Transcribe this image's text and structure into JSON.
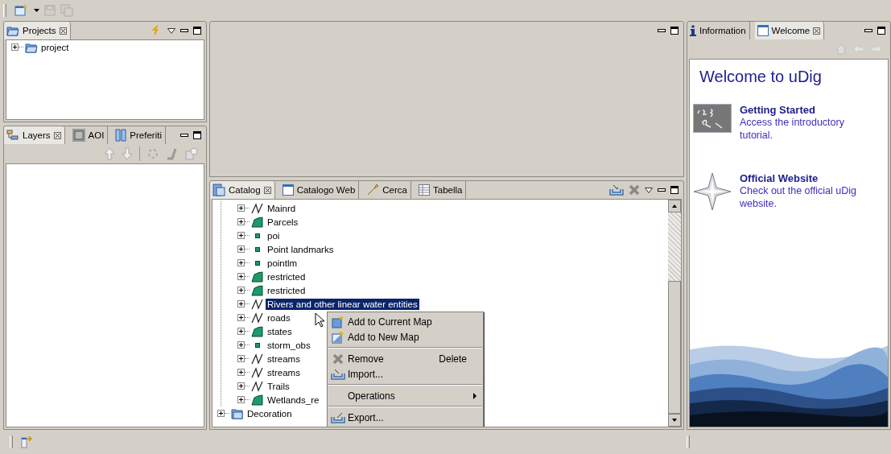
{
  "projects_panel": {
    "tabs": [
      {
        "label": "Projects",
        "selected": true,
        "closable": true
      }
    ],
    "items": [
      {
        "label": "project",
        "expanded": false
      }
    ]
  },
  "layers_panel": {
    "tabs": [
      {
        "label": "Layers",
        "selected": true,
        "closable": true
      },
      {
        "label": "AOI",
        "selected": false,
        "closable": false
      },
      {
        "label": "Preferiti",
        "selected": false,
        "closable": false
      }
    ]
  },
  "catalog_panel": {
    "tabs": [
      {
        "label": "Catalog",
        "selected": true,
        "closable": true
      },
      {
        "label": "Catalogo Web",
        "selected": false,
        "closable": false
      },
      {
        "label": "Cerca",
        "selected": false,
        "closable": false
      },
      {
        "label": "Tabella",
        "selected": false,
        "closable": false
      }
    ],
    "layers": [
      {
        "label": "Mainrd",
        "kind": "line",
        "selected": false
      },
      {
        "label": "Parcels",
        "kind": "polygon",
        "selected": false
      },
      {
        "label": "poi",
        "kind": "point",
        "selected": false
      },
      {
        "label": "Point landmarks",
        "kind": "point",
        "selected": false
      },
      {
        "label": "pointlm",
        "kind": "point",
        "selected": false
      },
      {
        "label": "restricted",
        "kind": "polygon",
        "selected": false
      },
      {
        "label": "restricted",
        "kind": "polygon",
        "selected": false
      },
      {
        "label": "Rivers and other linear water entities",
        "kind": "line",
        "selected": true
      },
      {
        "label": "roads",
        "kind": "line",
        "selected": false
      },
      {
        "label": "states",
        "kind": "polygon",
        "selected": false
      },
      {
        "label": "storm_obs",
        "kind": "point",
        "selected": false
      },
      {
        "label": "streams",
        "kind": "line",
        "selected": false
      },
      {
        "label": "streams",
        "kind": "line",
        "selected": false
      },
      {
        "label": "Trails",
        "kind": "line",
        "selected": false
      },
      {
        "label": "Wetlands_re",
        "kind": "polygon",
        "selected": false
      }
    ],
    "services": [
      {
        "label": "Decoration",
        "expanded": false
      }
    ]
  },
  "context_menu": {
    "groups": [
      [
        {
          "label": "Add to Current Map"
        },
        {
          "label": "Add to New Map"
        }
      ],
      [
        {
          "label": "Remove",
          "shortcut": "Delete"
        },
        {
          "label": "Import..."
        }
      ],
      [
        {
          "label": "Operations",
          "submenu": true
        }
      ],
      [
        {
          "label": "Export..."
        }
      ]
    ]
  },
  "welcome_panel": {
    "tabs": [
      {
        "label": "Information",
        "selected": false,
        "closable": false
      },
      {
        "label": "Welcome",
        "selected": true,
        "closable": true
      }
    ],
    "title": "Welcome to uDig",
    "entries": [
      {
        "title": "Getting Started",
        "text": "Access the introductory tutorial."
      },
      {
        "title": "Official Website",
        "text": "Check out the official uDig website."
      }
    ]
  }
}
